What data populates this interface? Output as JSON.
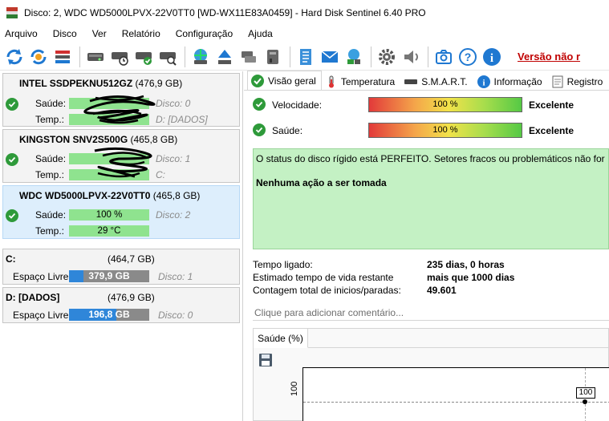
{
  "window": {
    "title": "Disco: 2, WDC WD5000LPVX-22V0TT0 [WD-WX11E83A0459]  -  Hard Disk Sentinel 6.40 PRO"
  },
  "menu": [
    {
      "label": "Arquivo"
    },
    {
      "label": "Disco"
    },
    {
      "label": "Ver"
    },
    {
      "label": "Relatório"
    },
    {
      "label": "Configuração"
    },
    {
      "label": "Ajuda"
    }
  ],
  "toolbar": {
    "buttons": [
      {
        "icon": "refresh-icon"
      },
      {
        "icon": "refresh-settings-icon"
      },
      {
        "icon": "disk-list-icon"
      },
      {
        "icon": "disk-info-icon"
      },
      {
        "icon": "disk-clock-icon"
      },
      {
        "icon": "disk-check-icon"
      },
      {
        "icon": "disk-search-icon"
      },
      {
        "icon": "globe-disk-icon"
      },
      {
        "icon": "eject-icon"
      },
      {
        "icon": "network-disk-icon"
      },
      {
        "icon": "usb-disk-icon"
      },
      {
        "icon": "notepad-icon"
      },
      {
        "icon": "mail-icon"
      },
      {
        "icon": "network-icon"
      },
      {
        "icon": "gear-icon"
      },
      {
        "icon": "sound-icon"
      },
      {
        "icon": "screenshot-icon"
      },
      {
        "icon": "help-icon"
      },
      {
        "icon": "info-icon"
      }
    ],
    "upgrade_link": "Versão não r"
  },
  "disks": [
    {
      "model": "INTEL SSDPEKNU512GZ",
      "size": "(476,9 GB)",
      "health_label": "Saúde:",
      "temp_label": "Temp.:",
      "health_hint": "Disco: 0",
      "temp_hint": "D: [DADOS]"
    },
    {
      "model": "KINGSTON SNV2S500G",
      "size": "(465,8 GB)",
      "health_label": "Saúde:",
      "temp_label": "Temp.:",
      "health_hint": "Disco: 1",
      "temp_hint": "C:"
    },
    {
      "model": "WDC WD5000LPVX-22V0TT0",
      "size": "(465,8 GB)",
      "health_label": "Saúde:",
      "temp_label": "Temp.:",
      "health_value": "100 %",
      "temp_value": "29 °C",
      "health_hint": "Disco: 2",
      "selected": true
    }
  ],
  "partitions": [
    {
      "name": "C:",
      "size": "(464,7 GB)",
      "free_label": "Espaço Livre",
      "free_value": "379,9 GB",
      "free_fraction": 0.18,
      "hint": "Disco: 1"
    },
    {
      "name": "D: [DADOS]",
      "size": "(476,9 GB)",
      "free_label": "Espaço Livre",
      "free_value": "196,8 GB",
      "free_fraction": 0.59,
      "hint": "Disco: 0"
    }
  ],
  "tabs": [
    {
      "label": "Visão geral",
      "icon": "check-icon",
      "active": true
    },
    {
      "label": "Temperatura",
      "icon": "thermometer-icon"
    },
    {
      "label": "S.M.A.R.T.",
      "icon": "smart-icon"
    },
    {
      "label": "Informação",
      "icon": "info-icon"
    },
    {
      "label": "Registro",
      "icon": "log-icon"
    }
  ],
  "overview": {
    "speed": {
      "label": "Velocidade:",
      "value": "100 %",
      "percent": 100,
      "rating": "Excelente"
    },
    "health": {
      "label": "Saúde:",
      "value": "100 %",
      "percent": 100,
      "rating": "Excelente"
    },
    "status_message": "O status do disco rígido está PERFEITO. Setores fracos ou problemáticos não for",
    "action_message": "Nenhuma ação a ser tomada",
    "stats": [
      {
        "label": "Tempo ligado:",
        "value": "235 dias, 0 horas"
      },
      {
        "label": "Estimado tempo de vida restante",
        "value": "mais que 1000 dias"
      },
      {
        "label": "Contagem total de inicios/paradas:",
        "value": "49.601"
      }
    ],
    "comment_placeholder": "Clique para adicionar  comentário..."
  },
  "chart_data": {
    "type": "line",
    "tab_label": "Saúde (%)",
    "ylabel": "100",
    "point_label": "100",
    "series": [
      {
        "values": [
          100
        ]
      }
    ]
  },
  "colors": {
    "selected_bg": "#ddeefc",
    "health_green": "#8fe38f",
    "info_green": "#c4f1c4",
    "free_space_blue": "#2f86d9",
    "link_red": "#c00000",
    "check_green": "#2e9a3a"
  }
}
